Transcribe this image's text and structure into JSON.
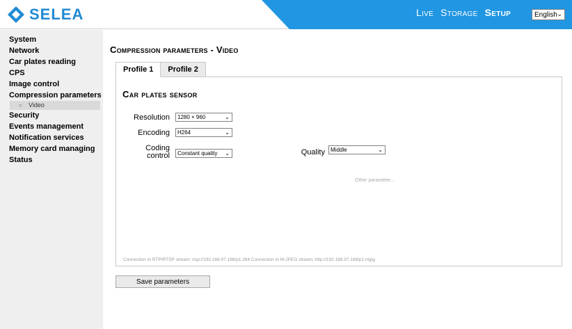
{
  "brand": {
    "name": "SELEA",
    "logo_color": "#1f8ad3",
    "banner_color": "#2196e3"
  },
  "topnav": {
    "items": [
      {
        "label": "Live"
      },
      {
        "label": "Storage"
      },
      {
        "label": "Setup"
      }
    ],
    "language": "English"
  },
  "sidebar": {
    "items": [
      {
        "label": "System"
      },
      {
        "label": "Network"
      },
      {
        "label": "Car plates reading"
      },
      {
        "label": "CPS"
      },
      {
        "label": "Image control"
      },
      {
        "label": "Compression parameters"
      }
    ],
    "sub_item": "Video",
    "items_after": [
      {
        "label": "Security"
      },
      {
        "label": "Events management"
      },
      {
        "label": "Notification services"
      },
      {
        "label": "Memory card managing"
      },
      {
        "label": "Status"
      }
    ]
  },
  "main": {
    "title": "Compression parameters - Video",
    "tabs": [
      {
        "label": "Profile 1"
      },
      {
        "label": "Profile 2"
      }
    ],
    "section_title": "Car plates sensor",
    "resolution_label": "Resolution",
    "resolution_value": "1280 × 960",
    "encoding_label": "Encoding",
    "encoding_value": "H264",
    "coding_control_label_1": "Coding",
    "coding_control_label_2": "control",
    "coding_control_value": "Constant quality",
    "quality_label": "Quality",
    "quality_value": "Middle",
    "other_parameter": "Other parameter...",
    "connection_text": "Connection to RTP/RTSP stream: rtsp://192.168.97.188/p1.264   Connection to M-JPEG stream: http://192.168.97.188/p1.mjpg",
    "save_label": "Save parameters"
  }
}
